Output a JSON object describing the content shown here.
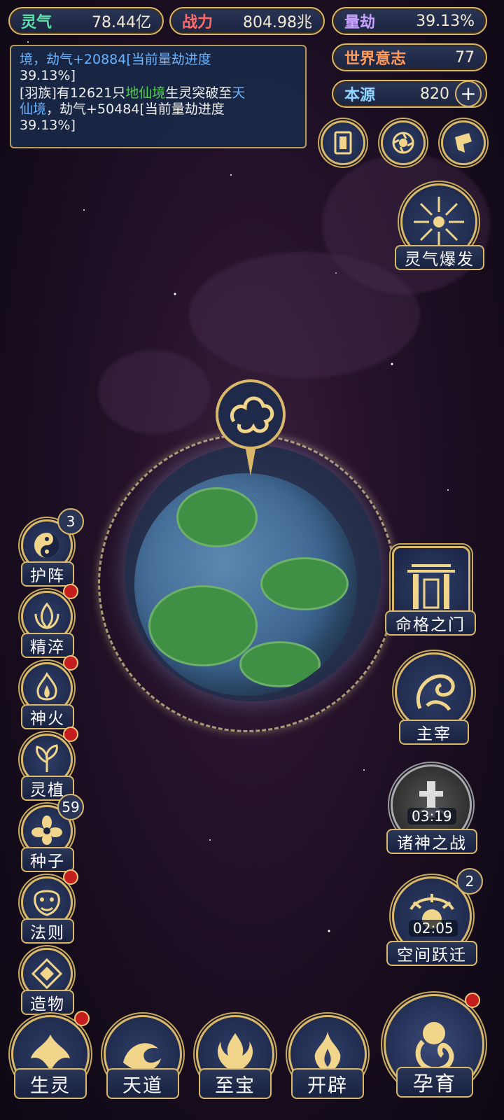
{
  "stats": {
    "lingqi": {
      "label": "灵气",
      "value": "78.44亿",
      "color": "#5fe0a8"
    },
    "zhanli": {
      "label": "战力",
      "value": "804.98兆",
      "color": "#ff6a6a"
    },
    "liangjie": {
      "label": "量劫",
      "value": "39.13%",
      "color": "#c9a0ff"
    },
    "shijie": {
      "label": "世界意志",
      "value": "77",
      "color": "#ff9a5a"
    },
    "benyuan": {
      "label": "本源",
      "value": "820",
      "color": "#8fd4ff"
    }
  },
  "log": {
    "line1a": "境，劫气+20884[当前量劫进度",
    "line1b": "39.13%]",
    "line2a": "[羽族]有12621只",
    "line2b": "地仙境",
    "line2c": "生灵突破至",
    "line2d": "天",
    "line3a": "仙境",
    "line3b": "，劫气+50484[当前量劫进度",
    "line4": "39.13%]"
  },
  "right_buttons": {
    "burst": "灵气爆发",
    "gate": "命格之门",
    "ruler": "主宰",
    "war": "诸神之战",
    "war_timer": "03:19",
    "warp": "空间跃迁",
    "warp_timer": "02:05",
    "warp_badge": "2"
  },
  "left_buttons": {
    "guard": "护阵",
    "guard_badge": "3",
    "refine": "精淬",
    "fire": "神火",
    "plant": "灵植",
    "seed": "种子",
    "seed_badge": "59",
    "law": "法则",
    "create": "造物"
  },
  "bottom_buttons": {
    "life": "生灵",
    "heaven": "天道",
    "treasure": "至宝",
    "open": "开辟",
    "breed": "孕育"
  }
}
